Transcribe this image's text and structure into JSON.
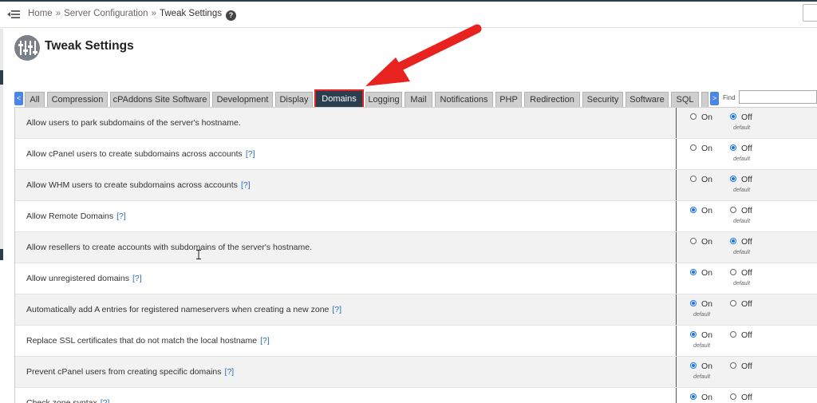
{
  "breadcrumb": {
    "items": [
      "Home",
      "Server Configuration",
      "Tweak Settings"
    ],
    "separator": "»"
  },
  "help_icon_glyph": "?",
  "page_title": "Tweak Settings",
  "tabs": {
    "prev": "<",
    "next": ">",
    "items": [
      "All",
      "Compression",
      "cPAddons Site Software",
      "Development",
      "Display",
      "Domains",
      "Logging",
      "Mail",
      "Notifications",
      "PHP",
      "Redirection",
      "Security",
      "Software",
      "SQL"
    ],
    "active": "Domains"
  },
  "find": {
    "label": "Find",
    "value": ""
  },
  "options": {
    "on_label": "On",
    "off_label": "Off",
    "default_label": "default",
    "help_link": "[?]"
  },
  "settings": [
    {
      "label": "Allow users to park subdomains of the server's hostname.",
      "help": false,
      "selected": "off",
      "default": "off"
    },
    {
      "label": "Allow cPanel users to create subdomains across accounts",
      "help": true,
      "selected": "off",
      "default": "off"
    },
    {
      "label": "Allow WHM users to create subdomains across accounts",
      "help": true,
      "selected": "off",
      "default": "off"
    },
    {
      "label": "Allow Remote Domains",
      "help": true,
      "selected": "on",
      "default": "off"
    },
    {
      "label": "Allow resellers to create accounts with subdomains of the server's hostname.",
      "help": false,
      "selected": "off",
      "default": "off"
    },
    {
      "label": "Allow unregistered domains",
      "help": true,
      "selected": "on",
      "default": "off"
    },
    {
      "label": "Automatically add A entries for registered nameservers when creating a new zone",
      "help": true,
      "selected": "on",
      "default": "on"
    },
    {
      "label": "Replace SSL certificates that do not match the local hostname",
      "help": true,
      "selected": "on",
      "default": "on"
    },
    {
      "label": "Prevent cPanel users from creating specific domains",
      "help": true,
      "selected": "on",
      "default": "on"
    },
    {
      "label": "Check zone syntax",
      "help": true,
      "selected": "on",
      "default": "none"
    }
  ],
  "colors": {
    "topbar_border": "#2b3e50",
    "active_tab": "#2b3e50",
    "highlight": "#e8231f",
    "link": "#2a6ebb",
    "radio_checked": "#1a73e8"
  },
  "icons": {
    "menu": "menu-toggle-icon",
    "page": "sliders-icon",
    "annotation": "red-arrow-annotation"
  }
}
